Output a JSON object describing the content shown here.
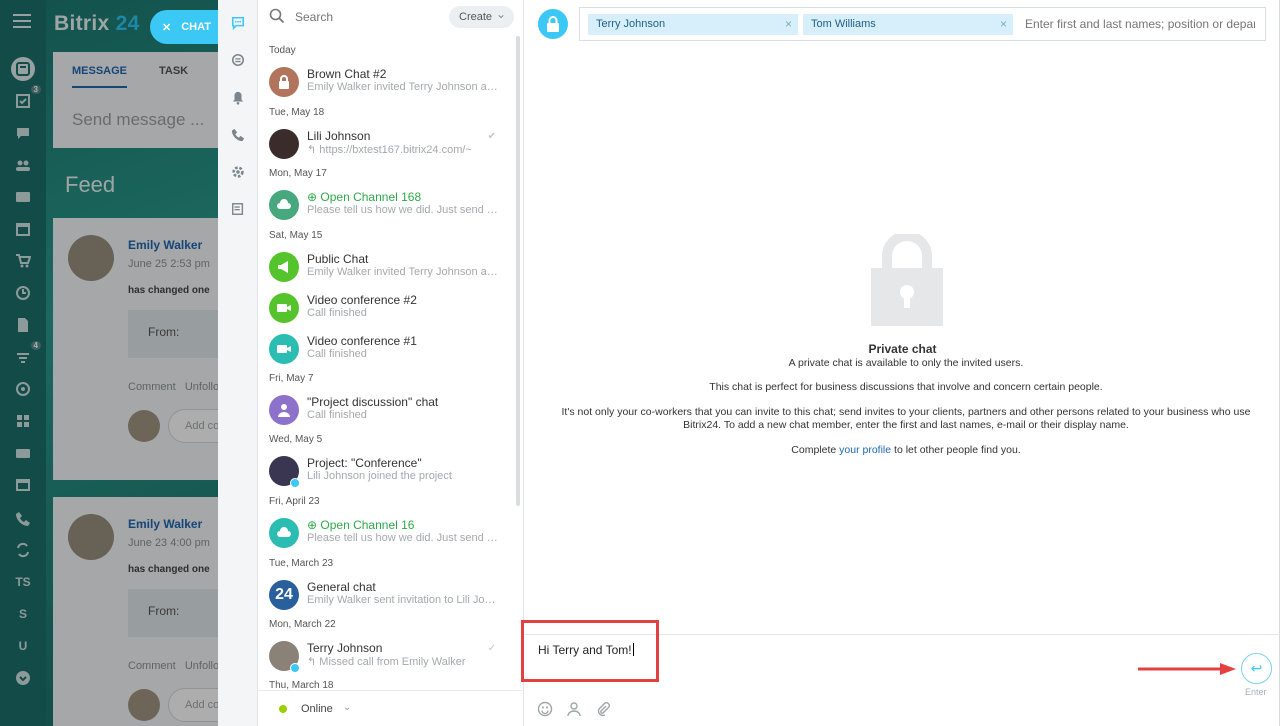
{
  "portal": {
    "logo_main": "Bitrix",
    "logo_num": "24",
    "chat_button": "CHAT",
    "tabs": [
      "MESSAGE",
      "TASK"
    ],
    "send_message": "Send message ...",
    "feed_title": "Feed",
    "posts": [
      {
        "name": "Emily Walker",
        "date": "June 25 2:53 pm",
        "changed": "has changed one",
        "from": "From:",
        "comment": "Comment",
        "unfollow": "Unfollo",
        "add": "Add co"
      },
      {
        "name": "Emily Walker",
        "date": "June 23 4:00 pm",
        "changed": "has changed one",
        "from": "From:",
        "comment": "Comment",
        "unfollow": "Unfollo",
        "add": "Add co"
      }
    ],
    "sidebar_badges": {
      "tasks": "3",
      "filters": "4"
    },
    "sidebar_letters": [
      "TS",
      "S",
      "U"
    ]
  },
  "search": {
    "placeholder": "Search",
    "create_label": "Create"
  },
  "recent": {
    "sections": [
      {
        "label": "Today"
      },
      {
        "label": "Tue, May 18"
      },
      {
        "label": "Mon, May 17"
      },
      {
        "label": "Sat, May 15"
      },
      {
        "label": "Fri, May 7"
      },
      {
        "label": "Wed, May 5"
      },
      {
        "label": "Fri, April 23"
      },
      {
        "label": "Tue, March 23"
      },
      {
        "label": "Mon, March 22"
      },
      {
        "label": "Thu, March 18"
      }
    ],
    "items": [
      {
        "name": "Brown Chat #2",
        "sub": "Emily Walker invited Terry Johnson and Tom Williams",
        "color": "#b1755e",
        "icon": "lock-icon"
      },
      {
        "name": "Lili Johnson",
        "sub": "https://bxtest167.bitrix24.com/~",
        "color": "#3b2c2c",
        "icon": "user-avatar"
      },
      {
        "name": "Open Channel 168",
        "sub": "Please tell us how we did. Just send us a rating",
        "color": "#47a87d",
        "icon": "open-channel-icon"
      },
      {
        "name": "Public Chat",
        "sub": "Emily Walker invited Terry Johnson and Tom Williams",
        "color": "#55c32b",
        "icon": "megaphone-icon"
      },
      {
        "name": "Video conference #2",
        "sub": "Call finished",
        "color": "#55c32b",
        "icon": "video-icon"
      },
      {
        "name": "Video conference #1",
        "sub": "Call finished",
        "color": "#2bbdb1",
        "icon": "video-icon"
      },
      {
        "name": "\"Project discussion\" chat",
        "sub": "Call finished",
        "color": "#8e71cb",
        "icon": "user-icon"
      },
      {
        "name": "Project: \"Conference\"",
        "sub": "Lili Johnson joined the project",
        "color": "#3a3550",
        "icon": "project-avatar"
      },
      {
        "name": "Open Channel 16",
        "sub": "Please tell us how we did. Just send us a rating",
        "color": "#2bbdb1",
        "icon": "open-channel-icon"
      },
      {
        "name": "General chat",
        "sub": "Emily Walker sent invitation to Lili Johnson",
        "color": "#2a5f9e",
        "icon": "bitrix24-icon",
        "avatar_text": "24"
      },
      {
        "name": "Terry Johnson",
        "sub": "Missed call from Emily Walker",
        "color": "#8a8178",
        "icon": "user-avatar"
      }
    ],
    "status": "Online"
  },
  "chat": {
    "members": [
      "Terry Johnson",
      "Tom Williams"
    ],
    "member_placeholder": "Enter first and last names; position or department",
    "title": "Private chat",
    "line1": "A private chat is available to only the invited users.",
    "line2": "This chat is perfect for business discussions that involve and concern certain people.",
    "line3": "It's not only your co-workers that you can invite to this chat; send invites to your clients, partners and other persons related to your business who use Bitrix24. To add a new chat member, enter the first and last names, e-mail or their display name.",
    "line4_pre": "Complete ",
    "line4_link": "your profile",
    "line4_post": " to let other people find you.",
    "message": "Hi Terry and Tom!",
    "send_hint": "Enter"
  },
  "colors": {
    "accent": "#3bc8f5",
    "highlight": "#e54041",
    "link": "#2067b0",
    "online": "#9dcf00"
  }
}
